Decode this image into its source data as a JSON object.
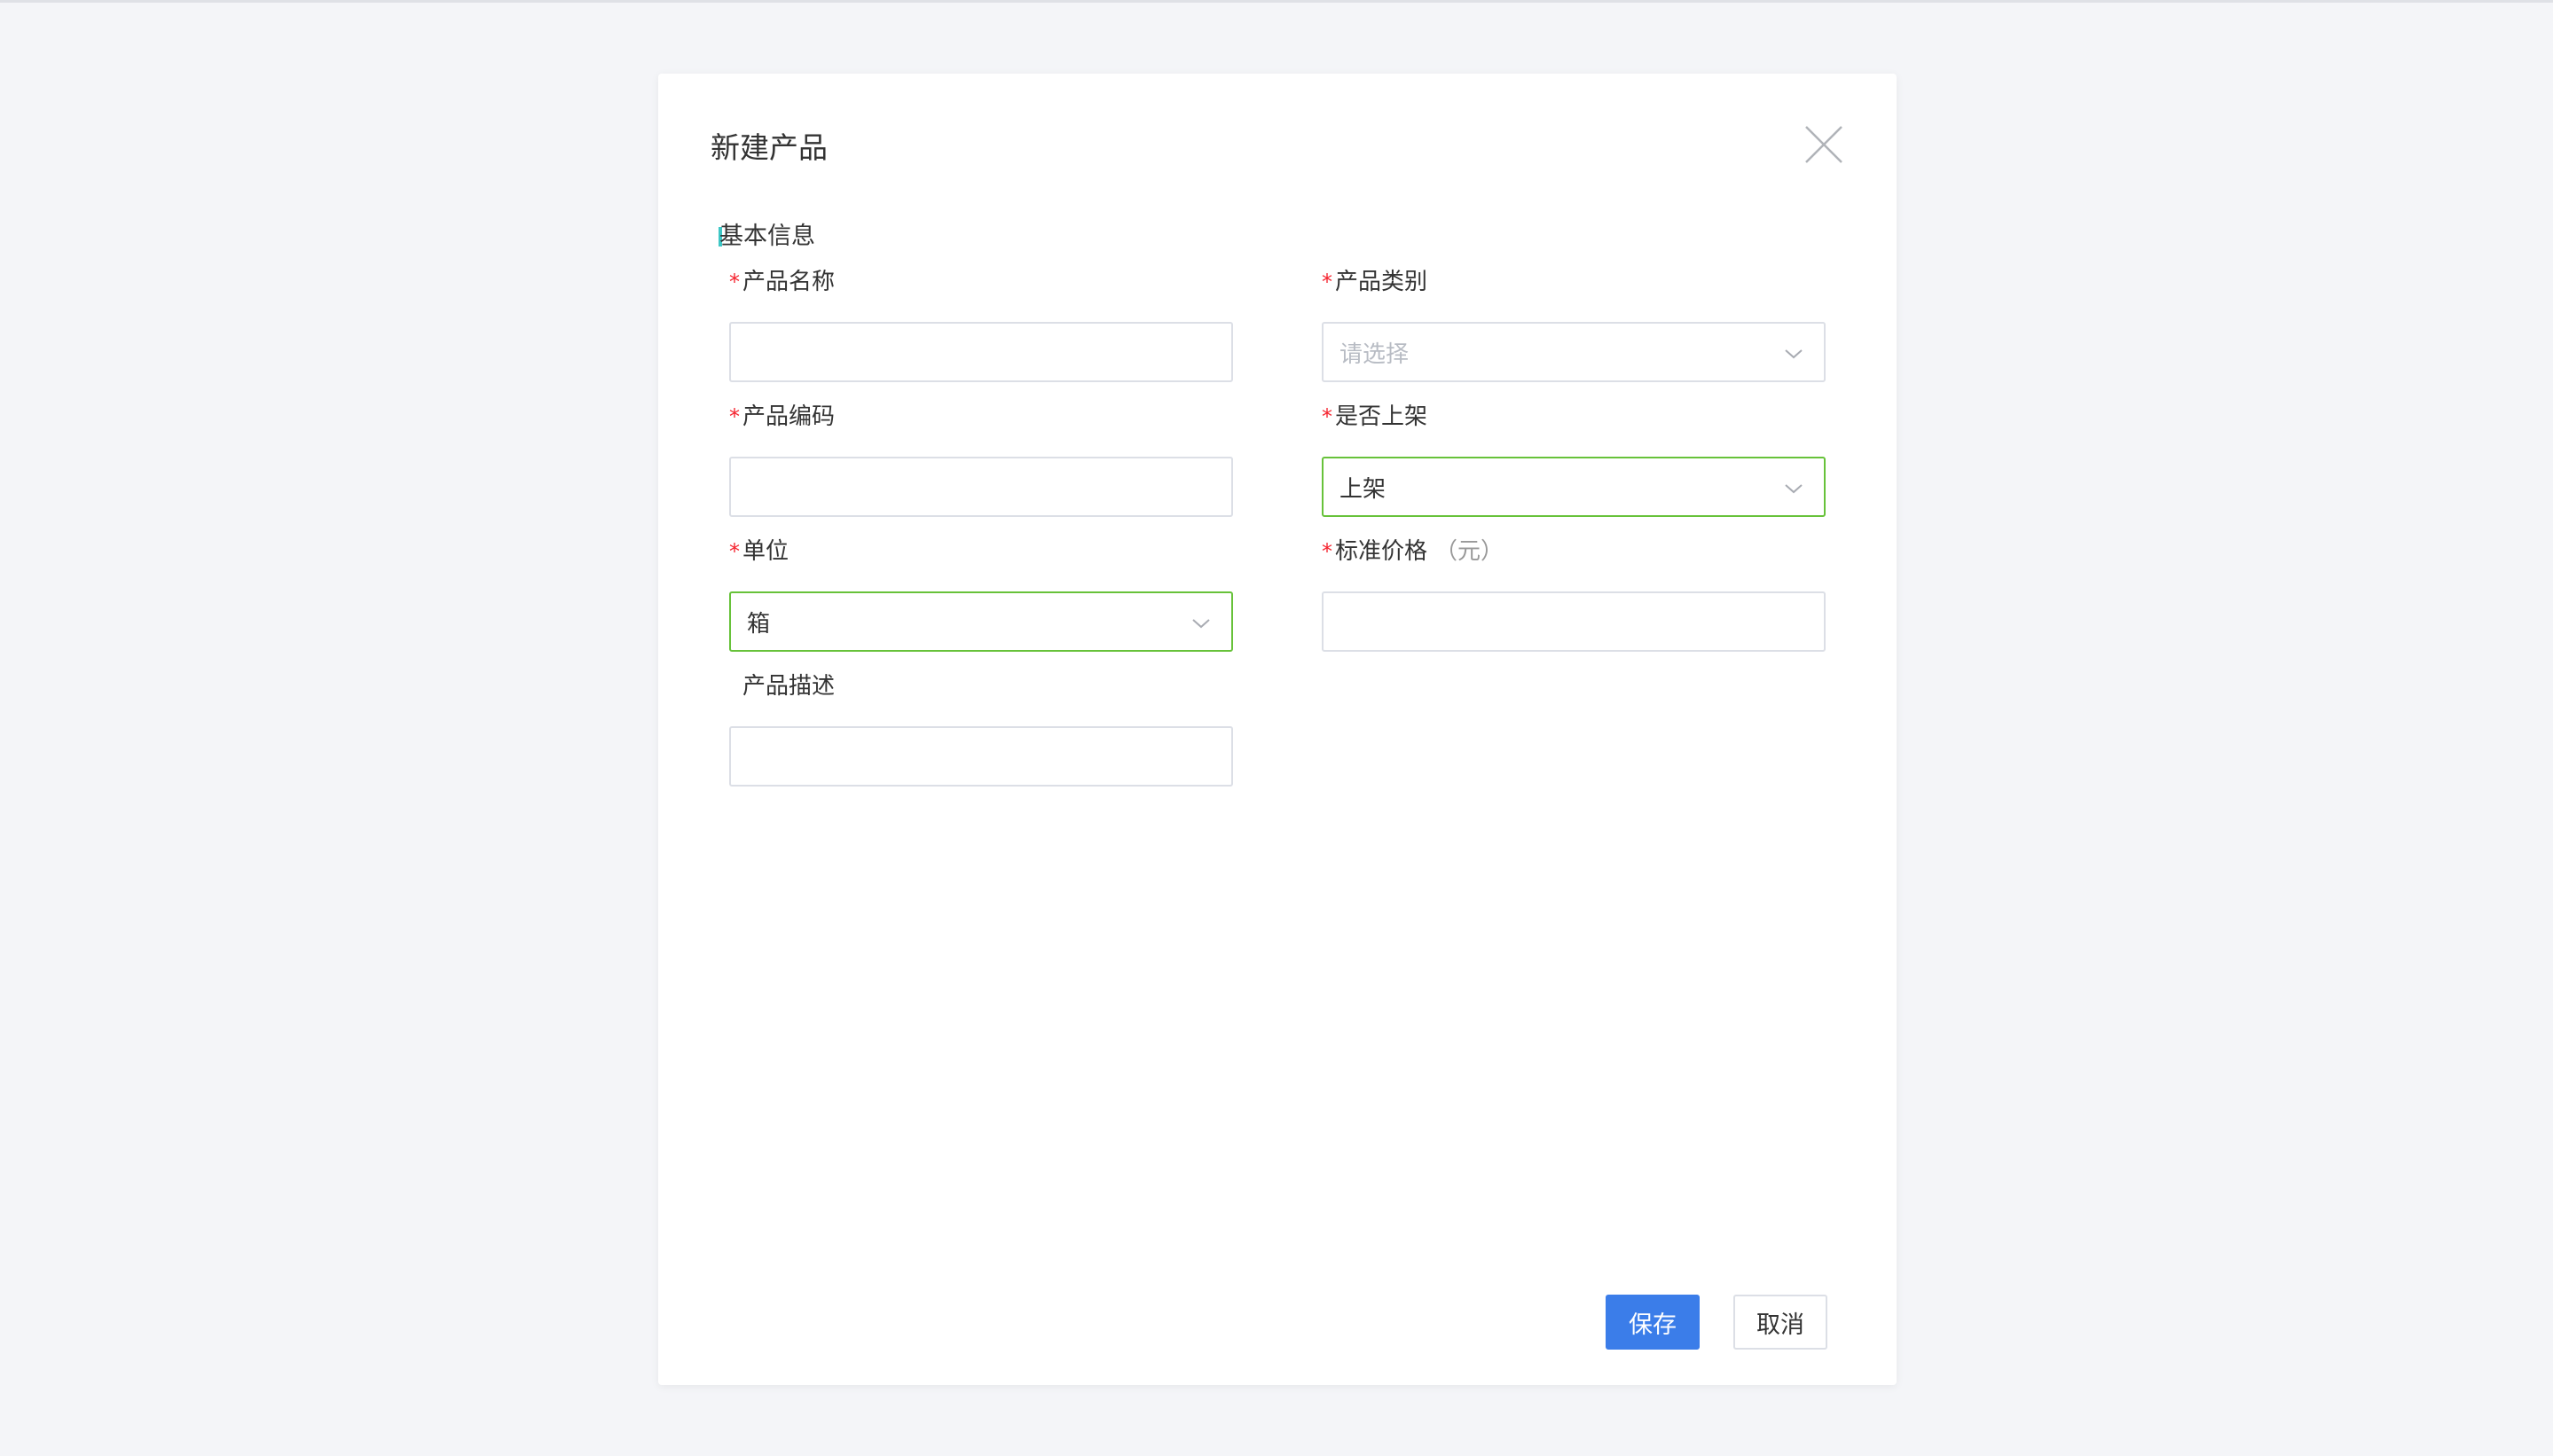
{
  "dialog": {
    "title": "新建产品",
    "section_title": "基本信息"
  },
  "fields": {
    "product_name": {
      "label": "产品名称",
      "required": "*",
      "value": ""
    },
    "product_category": {
      "label": "产品类别",
      "required": "*",
      "placeholder": "请选择"
    },
    "product_code": {
      "label": "产品编码",
      "required": "*",
      "value": ""
    },
    "on_shelf": {
      "label": "是否上架",
      "required": "*",
      "value": "上架"
    },
    "unit": {
      "label": "单位",
      "required": "*",
      "value": "箱"
    },
    "standard_price": {
      "label": "标准价格",
      "required": "*",
      "unit_note": "（元）",
      "value": ""
    },
    "description": {
      "label": "产品描述",
      "value": ""
    }
  },
  "actions": {
    "save_label": "保存",
    "cancel_label": "取消"
  },
  "colors": {
    "accent": "#3b7de9",
    "section_bar": "#3ec7c6",
    "focus_border": "#67c23a",
    "required": "#f5222d"
  },
  "icons": {
    "close": "close-icon",
    "dropdown": "chevron-down-icon"
  }
}
